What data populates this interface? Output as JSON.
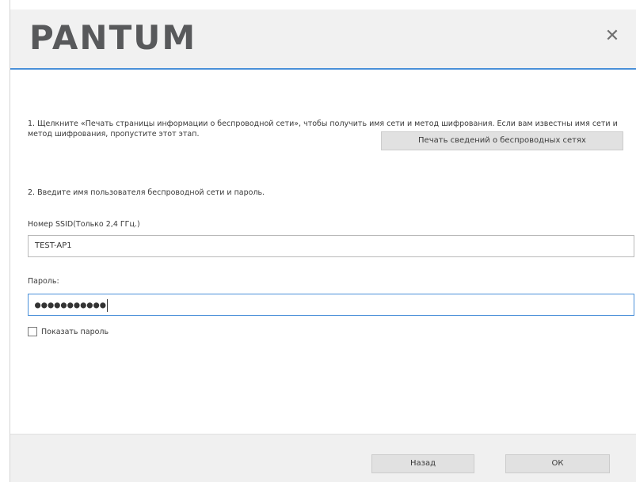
{
  "header": {
    "logo_text": "PANTUM",
    "close_label": "✕"
  },
  "step1": {
    "text": "1. Щелкните «Печать страницы информации о беспроводной сети», чтобы получить имя сети и метод шифрования. Если вам известны имя сети и метод шифрования, пропустите этот этап.",
    "print_button_label": "Печать сведений о беспроводных сетях"
  },
  "step2": {
    "text": "2. Введите имя пользователя беспроводной сети и пароль."
  },
  "ssid": {
    "label": "Номер SSID(Только 2,4 ГГц.)",
    "value": "TEST-AP1"
  },
  "password": {
    "label": "Пароль:",
    "value": "●●●●●●●●●●●"
  },
  "show_password": {
    "label": "Показать пароль",
    "checked": false
  },
  "footer": {
    "back_label": "Назад",
    "ok_label": "ОК"
  },
  "colors": {
    "accent": "#4a90d9",
    "logo": "#58595b",
    "header_bg": "#f1f1f1",
    "button_bg": "#e1e1e1"
  }
}
